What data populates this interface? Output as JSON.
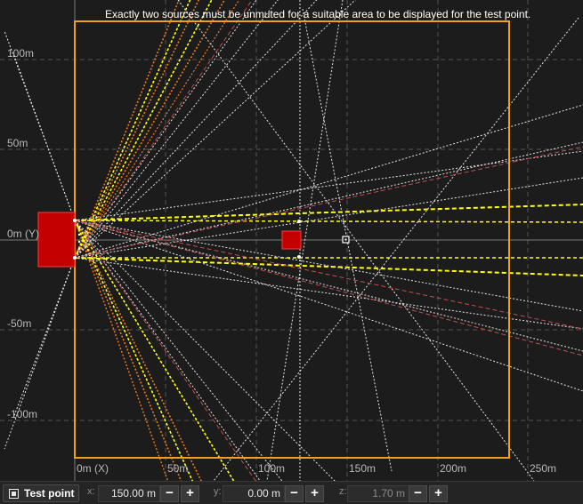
{
  "notice": "Exactly two sources must be unmuted for a suitable area to be displayed for the test point.",
  "y_axis_labels": [
    "100m",
    "50m",
    "0m (Y)",
    "-50m",
    "-100m"
  ],
  "x_axis_labels": [
    "0m (X)",
    "50m",
    "100m",
    "150m",
    "200m",
    "250m"
  ],
  "toolbar": {
    "test_point_label": "Test point",
    "x_label": "x:",
    "x_value": "150.00 m",
    "y_label": "y:",
    "y_value": "0.00 m",
    "z_label": "z:",
    "z_value": "1.70 m",
    "minus": "−",
    "plus": "+"
  },
  "colors": {
    "area_border": "#f0a020",
    "source": "#c40000",
    "coverage_yellow": "#ffff22",
    "coverage_orange": "#e87a28",
    "coverage_white": "#e6e6e6",
    "coverage_red": "#c05050"
  }
}
